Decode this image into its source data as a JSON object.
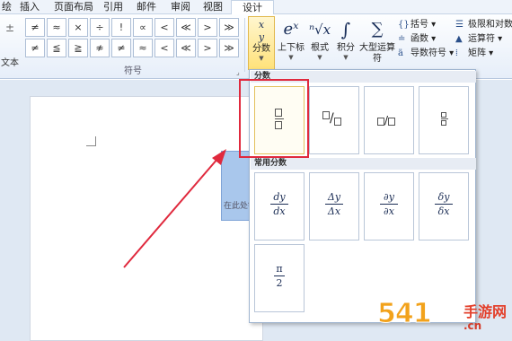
{
  "tabs": [
    "绘",
    "插入",
    "页面布局",
    "引用",
    "邮件",
    "审阅",
    "视图",
    "设计"
  ],
  "active_tab": "设计",
  "ribbon": {
    "left_row_symbols": [
      "±",
      "="
    ],
    "left_text": "文本",
    "symbol_rows": [
      [
        "≠",
        "≈",
        "×",
        "÷",
        "!",
        "∝",
        "<",
        "≪",
        ">",
        "≫"
      ],
      [
        "≠",
        "≦",
        "≧",
        "≉",
        "≠",
        "≈",
        "<",
        "≪",
        ">",
        "≫"
      ]
    ],
    "symbols_group_label": "符号",
    "structures": [
      {
        "icon": "x/y",
        "label": "分数",
        "active": true
      },
      {
        "icon": "eˣ",
        "label": "上下标",
        "active": false
      },
      {
        "icon": "ⁿ√x",
        "label": "根式",
        "active": false
      },
      {
        "icon": "∫",
        "label": "积分",
        "active": false
      },
      {
        "icon": "∑",
        "label": "大型运算符",
        "active": false
      }
    ],
    "small_col1": [
      {
        "icon": "{()}",
        "label": "括号"
      },
      {
        "icon": "sin",
        "label": "函数"
      },
      {
        "icon": "ä",
        "label": "导数符号"
      }
    ],
    "small_col2": [
      {
        "icon": "lim",
        "label": "极限和对数"
      },
      {
        "icon": "△",
        "label": "运算符"
      },
      {
        "icon": "[:]",
        "label": "矩阵"
      }
    ]
  },
  "document": {
    "placeholder": "在此处键入公式"
  },
  "gallery": {
    "section1_title": "分数",
    "section2_title": "常用分数",
    "fractions": [
      {
        "num": "dy",
        "den": "dx"
      },
      {
        "num": "Δy",
        "den": "Δx"
      },
      {
        "num": "∂y",
        "den": "∂x"
      },
      {
        "num": "δy",
        "den": "δx"
      },
      {
        "num": "π",
        "den": "2"
      }
    ],
    "slash": "/"
  },
  "watermark": {
    "main": "541",
    "side": "手游网",
    "url": ".cn"
  }
}
